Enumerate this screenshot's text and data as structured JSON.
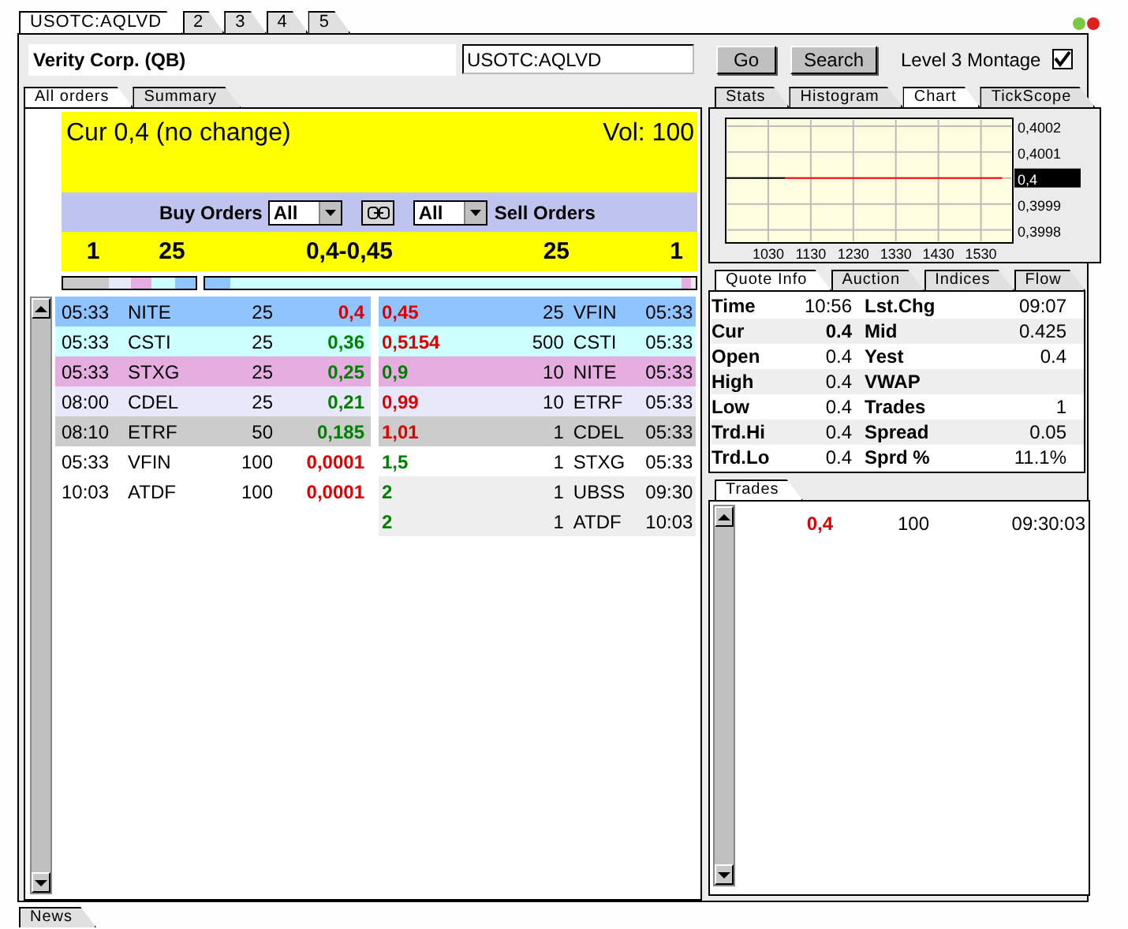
{
  "symbol_tabs": [
    {
      "label": "USOTC:AQLVD",
      "selected": true
    },
    {
      "label": "2",
      "selected": false
    },
    {
      "label": "3",
      "selected": false
    },
    {
      "label": "4",
      "selected": false
    },
    {
      "label": "5",
      "selected": false
    }
  ],
  "company": "Verity Corp. (QB)",
  "symbol_field": {
    "value": "USOTC:AQLVD"
  },
  "buttons": [
    "Go",
    "Search"
  ],
  "montage_checkbox": {
    "label": "Level 3 Montage",
    "checked": true
  },
  "left_tabs": [
    {
      "label": "All orders",
      "selected": true
    },
    {
      "label": "Summary",
      "selected": false
    }
  ],
  "summary": {
    "current": "Cur 0,4 (no change)",
    "volume": "Vol: 100"
  },
  "filter_bar": {
    "buy_label": "Buy Orders",
    "buy_filter": "All",
    "sell_filter": "All",
    "sell_label": "Sell Orders"
  },
  "inside": {
    "bid_count": "1",
    "bid_size": "25",
    "spread": "0,4-0,45",
    "ask_size": "25",
    "ask_count": "1"
  },
  "buy_orders": [
    {
      "time": "05:33",
      "mmid": "NITE",
      "size": "25",
      "price": {
        "text": "0,4",
        "color": "#dd0000"
      },
      "color": "#90c4ff"
    },
    {
      "time": "05:33",
      "mmid": "CSTI",
      "size": "25",
      "price": {
        "text": "0,36",
        "color": "#008000"
      },
      "color": "#ccffff"
    },
    {
      "time": "05:33",
      "mmid": "STXG",
      "size": "25",
      "price": {
        "text": "0,25",
        "color": "#008000"
      },
      "color": "#e6aee0"
    },
    {
      "time": "08:00",
      "mmid": "CDEL",
      "size": "25",
      "price": {
        "text": "0,21",
        "color": "#008000"
      },
      "color": "#e8e8fa"
    },
    {
      "time": "08:10",
      "mmid": "ETRF",
      "size": "50",
      "price": {
        "text": "0,185",
        "color": "#008000"
      },
      "color": "#cccccc"
    },
    {
      "time": "05:33",
      "mmid": "VFIN",
      "size": "100",
      "price": {
        "text": "0,0001",
        "color": "#dd0000"
      },
      "color": "#ffffff"
    },
    {
      "time": "10:03",
      "mmid": "ATDF",
      "size": "100",
      "price": {
        "text": "0,0001",
        "color": "#dd0000"
      },
      "color": "#ffffff"
    }
  ],
  "sell_orders": [
    {
      "price": {
        "text": "0,45",
        "color": "#dd0000"
      },
      "size": "25",
      "mmid": "VFIN",
      "time": "05:33",
      "color": "#90c4ff"
    },
    {
      "price": {
        "text": "0,5154",
        "color": "#dd0000"
      },
      "size": "500",
      "mmid": "CSTI",
      "time": "05:33",
      "color": "#ccffff"
    },
    {
      "price": {
        "text": "0,9",
        "color": "#008000"
      },
      "size": "10",
      "mmid": "NITE",
      "time": "05:33",
      "color": "#e6aee0"
    },
    {
      "price": {
        "text": "0,99",
        "color": "#dd0000"
      },
      "size": "10",
      "mmid": "ETRF",
      "time": "05:33",
      "color": "#e8e8fa"
    },
    {
      "price": {
        "text": "1,01",
        "color": "#dd0000"
      },
      "size": "1",
      "mmid": "CDEL",
      "time": "05:33",
      "color": "#cccccc"
    },
    {
      "price": {
        "text": "1,5",
        "color": "#008000"
      },
      "size": "1",
      "mmid": "STXG",
      "time": "05:33",
      "color": "#ffffff"
    },
    {
      "price": {
        "text": "2",
        "color": "#008000"
      },
      "size": "1",
      "mmid": "UBSS",
      "time": "09:30",
      "color": "#eeeeee"
    },
    {
      "price": {
        "text": "2",
        "color": "#008000"
      },
      "size": "1",
      "mmid": "ATDF",
      "time": "10:03",
      "color": "#eeeeee"
    }
  ],
  "chart_tabs": [
    {
      "label": "Stats",
      "selected": false
    },
    {
      "label": "Histogram",
      "selected": false
    },
    {
      "label": "Chart",
      "selected": true
    },
    {
      "label": "TickScope",
      "selected": false
    }
  ],
  "chart": {
    "chart_data": {
      "type": "line",
      "x": [
        930,
        1070,
        1580
      ],
      "series": [
        {
          "color": "#000000",
          "values": [
            0.4,
            0.4,
            null
          ]
        },
        {
          "color": "#ff0000",
          "values": [
            null,
            0.4,
            0.4
          ]
        }
      ],
      "grid": true,
      "xlim": [
        930,
        1605
      ],
      "ylim": [
        0.39975,
        0.40023
      ],
      "xticks": [
        1030,
        1130,
        1230,
        1330,
        1430,
        1530
      ],
      "yticks": [
        {
          "value": 0.4002,
          "label": "0,4002"
        },
        {
          "value": 0.4001,
          "label": "0,4001"
        },
        {
          "value": 0.4,
          "label": "0,4"
        },
        {
          "value": 0.3999,
          "label": "0,3999"
        },
        {
          "value": 0.3998,
          "label": "0,3998"
        }
      ]
    }
  },
  "quote_tabs": [
    {
      "label": "Quote Info",
      "selected": true
    },
    {
      "label": "Auction",
      "selected": false
    },
    {
      "label": "Indices",
      "selected": false
    },
    {
      "label": "Flow",
      "selected": false
    }
  ],
  "quote_info": [
    {
      "label": "Time",
      "value": "10:56",
      "label_2": "Lst.Chg",
      "value_2": "09:07"
    },
    {
      "label": "Cur",
      "value": "0.4",
      "value_bold": true,
      "label_2": "Mid",
      "value_2": "0.425"
    },
    {
      "label": "Open",
      "value": "0.4",
      "label_2": "Yest",
      "value_2": "0.4"
    },
    {
      "label": "High",
      "value": "0.4",
      "label_2": "VWAP"
    },
    {
      "label": "Low",
      "value": "0.4",
      "label_2": "Trades",
      "value_2": "1"
    },
    {
      "label": "Trd.Hi",
      "value": "0.4",
      "label_2": "Spread",
      "value_2": "0.05"
    },
    {
      "label": "Trd.Lo",
      "value": "0.4",
      "label_2": "Sprd %",
      "value_2": "11.1%"
    }
  ],
  "trades_tab": {
    "label": "Trades",
    "selected": true
  },
  "trades": [
    {
      "price": {
        "text": "0,4",
        "color": "#dd0000"
      },
      "size": "100",
      "time": "09:30:03"
    }
  ],
  "bottom_tab": {
    "label": "News",
    "selected": false
  }
}
